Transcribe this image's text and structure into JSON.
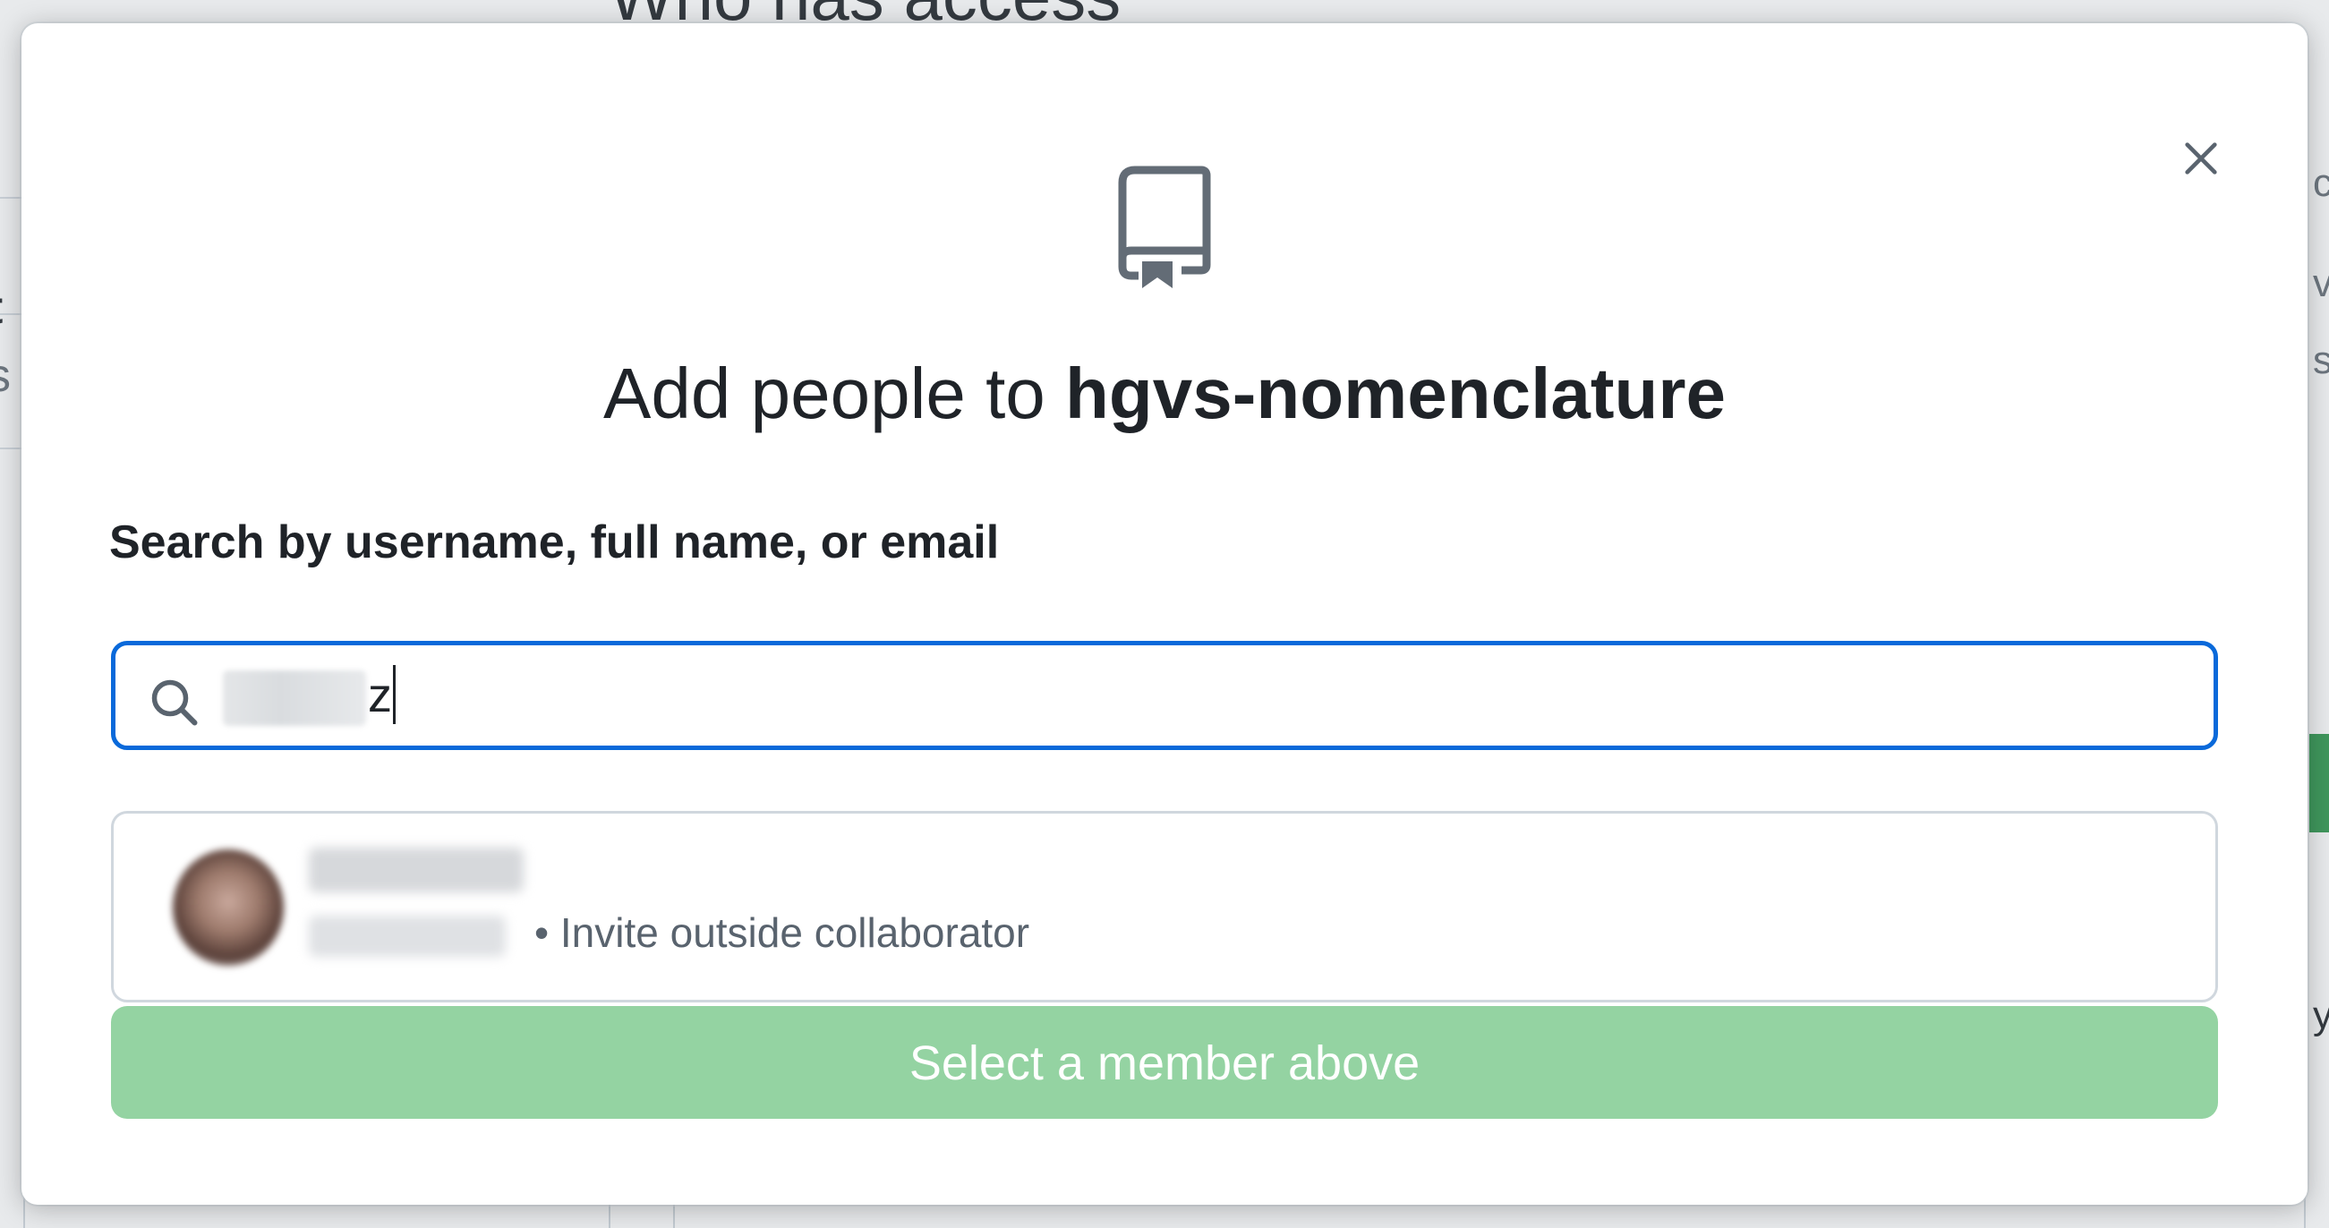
{
  "background": {
    "heading": "Who has access",
    "left_fragments": [
      "t",
      "s"
    ],
    "right_fragments": [
      "c",
      "v",
      "s",
      "y"
    ]
  },
  "dialog": {
    "title_prefix": "Add people to ",
    "repo_name": "hgvs-nomenclature",
    "search": {
      "label": "Search by username, full name, or email",
      "value": "z",
      "icon": "search-icon"
    },
    "result": {
      "invite_text": "• Invite outside collaborator"
    },
    "submit_label": "Select a member above",
    "icons": {
      "close": "close-icon",
      "repo": "repo-icon"
    }
  },
  "colors": {
    "focus_border": "#0969da",
    "submit_disabled_bg": "#94d3a2",
    "text_primary": "#1f2328",
    "text_muted": "#59636e"
  }
}
